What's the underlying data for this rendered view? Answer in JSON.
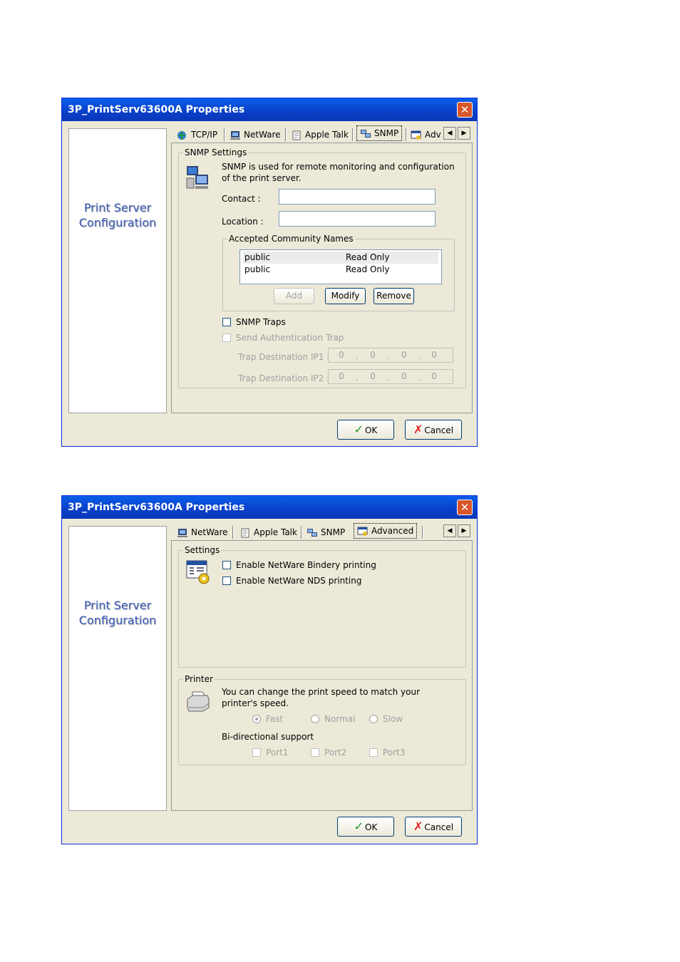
{
  "window1": {
    "title": "3P_PrintServ63600A Properties",
    "side_label": [
      "Print Server",
      "Configuration"
    ],
    "tabs": [
      {
        "label": "TCP/IP",
        "icon": "globe-network-icon"
      },
      {
        "label": "NetWare",
        "icon": "computer-icon"
      },
      {
        "label": "Apple Talk",
        "icon": "printer-page-icon"
      },
      {
        "label": "SNMP",
        "icon": "network-computers-icon",
        "selected": true
      },
      {
        "label": "Adv",
        "icon": "advanced-settings-icon"
      }
    ],
    "group_title": "SNMP Settings",
    "description": "SNMP is used for remote monitoring and configuration of the print server.",
    "contact_label": "Contact :",
    "contact_value": "",
    "location_label": "Location :",
    "location_value": "",
    "community_title": "Accepted Community Names",
    "community_rows": [
      {
        "name": "public",
        "access": "Read Only"
      },
      {
        "name": "public",
        "access": "Read Only"
      }
    ],
    "buttons": {
      "add": "Add",
      "modify": "Modify",
      "remove": "Remove"
    },
    "snmp_traps_label": "SNMP Traps",
    "auth_trap_label": "Send Authentication Trap",
    "trap_ip1_label": "Trap Destination IP1 :",
    "trap_ip2_label": "Trap Destination IP2 :",
    "trap_ip1": [
      "0",
      "0",
      "0",
      "0"
    ],
    "trap_ip2": [
      "0",
      "0",
      "0",
      "0"
    ],
    "ok": "OK",
    "cancel": "Cancel"
  },
  "window2": {
    "title": "3P_PrintServ63600A Properties",
    "side_label": [
      "Print Server",
      "Configuration"
    ],
    "tabs": [
      {
        "label": "NetWare",
        "icon": "computer-icon"
      },
      {
        "label": "Apple Talk",
        "icon": "printer-page-icon"
      },
      {
        "label": "SNMP",
        "icon": "network-computers-icon"
      },
      {
        "label": "Advanced",
        "icon": "advanced-settings-icon",
        "selected": true
      }
    ],
    "settings_title": "Settings",
    "bindery_label": "Enable NetWare Bindery printing",
    "nds_label": "Enable NetWare NDS printing",
    "printer_title": "Printer",
    "printer_description": "You can change the print speed to match your printer's speed.",
    "speeds": [
      "Fast",
      "Normal",
      "Slow"
    ],
    "speed_selected": "Fast",
    "bidir_label": "Bi-directional support",
    "ports": [
      "Port1",
      "Port2",
      "Port3"
    ],
    "ok": "OK",
    "cancel": "Cancel"
  },
  "colors": {
    "titlebar": "#0a4fd8",
    "dialog_bg": "#ece9d8",
    "side_text": "#3a5bb8",
    "close_button": "#d8552a"
  }
}
